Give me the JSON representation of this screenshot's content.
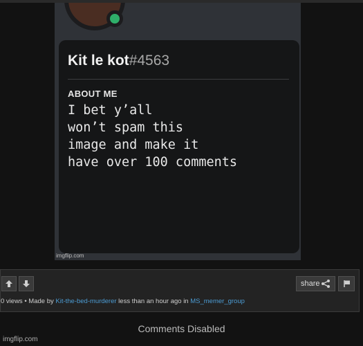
{
  "meme": {
    "username": "Kit le kot",
    "discriminator": "#4563",
    "about_heading": "ABOUT ME",
    "about_text": "I bet y’all\nwon’t spam this\nimage and make it\nhave over 100 comments",
    "watermark": "imgflip.com"
  },
  "actions": {
    "upvote_icon": "arrow-up-icon",
    "downvote_icon": "arrow-down-icon",
    "share_label": "share",
    "share_icon": "share-icon",
    "flag_icon": "flag-icon"
  },
  "meta": {
    "views": "0 views",
    "made_by_prefix": " • Made by ",
    "author": "Kit-the-bed-murderer",
    "time": " less than an hour ago in ",
    "stream": "MS_memer_group"
  },
  "comments_status": "Comments Disabled",
  "site_watermark": "imgflip.com",
  "colors": {
    "link": "#4c9cd4",
    "status_online": "#2faf6a",
    "card_bg": "#151617"
  }
}
